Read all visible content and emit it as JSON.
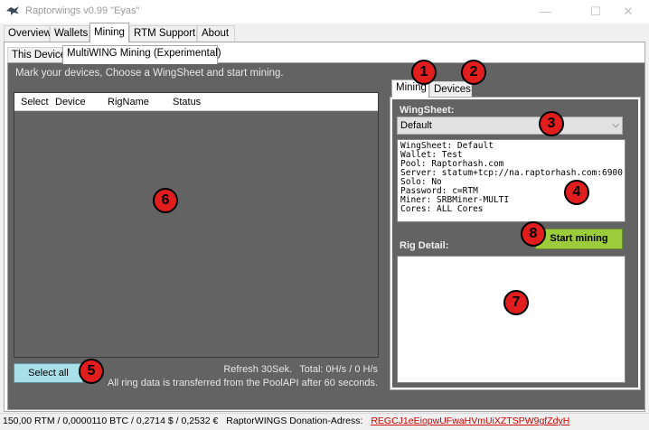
{
  "window": {
    "title": "Raptorwings v0.99 \"Eyas\"",
    "minimize_glyph": "—",
    "maximize_glyph": "☐",
    "close_glyph": "✕",
    "app_icon": "raptor-bird-icon"
  },
  "main_tabs": [
    {
      "label": "Overview",
      "active": false
    },
    {
      "label": "Wallets",
      "active": false
    },
    {
      "label": "Mining",
      "active": true
    },
    {
      "label": "RTM Support",
      "active": false
    },
    {
      "label": "About",
      "active": false
    }
  ],
  "sub_tabs": [
    {
      "label": "This Device",
      "active": false
    },
    {
      "label": "MultiWING Mining (Experimental)",
      "active": true
    }
  ],
  "mining": {
    "instruction": "Mark your devices, Choose a WingSheet and start mining.",
    "table_headers": [
      "Select",
      "Device",
      "RigName",
      "Status"
    ],
    "select_all_label": "Select all",
    "refresh_label": "Refresh 30Sek.",
    "total_label": "Total: 0H/s / 0 H/s",
    "transfer_note": "All ring data is transferred from the PoolAPI after 60 seconds."
  },
  "right_tabs": [
    {
      "label": "Mining",
      "active": true
    },
    {
      "label": "Devices",
      "active": false
    }
  ],
  "wingsheet": {
    "label": "WingSheet:",
    "selected": "Default",
    "info_lines": [
      "WingSheet: Default",
      "Wallet: Test",
      "Pool: Raptorhash.com",
      "Server: statum+tcp://na.raptorhash.com:6900",
      "Solo: No",
      "Password: c=RTM",
      "Miner: SRBMiner-MULTI",
      "Cores: ALL Cores"
    ]
  },
  "start_button_label": "Start mining",
  "rig_detail_label": "Rig Detail:",
  "status_bar": {
    "prices": "150,00 RTM / 0,0000110 BTC / 0,2714 $ / 0,2532 €",
    "donation_label": "RaptorWINGS Donation-Adress:",
    "donation_address": "REGCJ1eEiopwUFwaHVmUiXZTSPW9gfZdyH"
  },
  "annotations": [
    "1",
    "2",
    "3",
    "4",
    "5",
    "6",
    "7",
    "8"
  ],
  "colors": {
    "panel": "#636363",
    "start_button": "#9ccc3c",
    "select_all_button": "#a9dfe8",
    "donation_address": "#d00000",
    "marker": "#e11d1d"
  }
}
